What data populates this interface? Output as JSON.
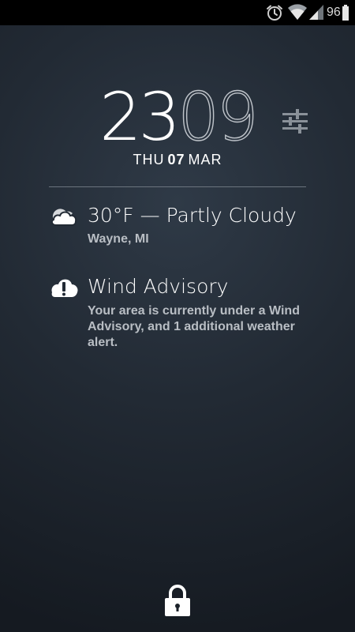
{
  "status_bar": {
    "battery_level": "96",
    "icons": [
      "alarm-icon",
      "wifi-icon",
      "signal-icon",
      "battery-icon"
    ]
  },
  "clock": {
    "hours": "23",
    "minutes": "09"
  },
  "date": {
    "weekday": "THU",
    "day": "07",
    "month": "MAR"
  },
  "weather": {
    "title": "30°F — Partly Cloudy",
    "location": "Wayne, MI",
    "icon": "partly-cloudy-icon"
  },
  "alert": {
    "title": "Wind Advisory",
    "description": "Your area is currently under a Wind Advisory, and 1 additional weather alert.",
    "icon": "alert-cloud-icon"
  },
  "lock": {
    "icon": "lock-icon"
  },
  "colors": {
    "background": "#222a34",
    "status_bar": "#000000",
    "text_primary": "#ffffff",
    "text_secondary": "#b9bec4",
    "divider": "#6b747e"
  }
}
